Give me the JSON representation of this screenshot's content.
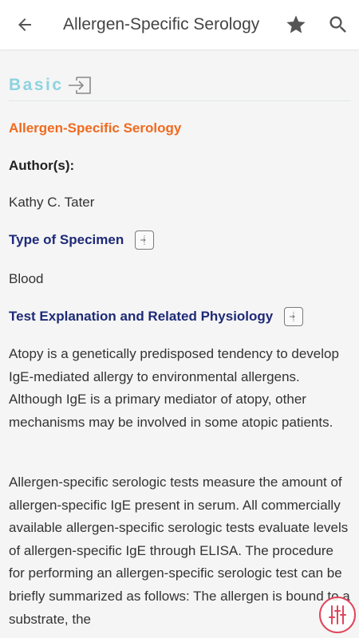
{
  "appbar": {
    "title": "Allergen-Specific Serology",
    "back_icon": "arrow-left-icon",
    "favorite_icon": "star-icon",
    "search_icon": "search-icon"
  },
  "section": {
    "label": "Basic",
    "icon": "enter-icon",
    "color": "#8dd3e0"
  },
  "document": {
    "title": "Allergen-Specific Serology",
    "title_color": "#f06a1e",
    "author_label": "Author(s):",
    "author_name": "Kathy C. Tater",
    "heading_color": "#1e2a78",
    "specimen_heading": "Type of Specimen",
    "specimen_value": "Blood",
    "physiology_heading": "Test Explanation and Related Physiology",
    "paragraphs": [
      "Atopy is a genetically predisposed tendency to develop IgE-mediated allergy to environmental allergens. Although IgE is a primary mediator of atopy, other mechanisms may be involved in some atopic patients.",
      "Allergen-specific serologic tests measure the amount of allergen-specific IgE present in serum. All commercially available allergen-specific serologic tests evaluate levels of allergen-specific IgE through ELISA. The procedure for performing an allergen-specific serologic test can be briefly summarized as follows: The allergen is bound to a substrate, the"
    ]
  },
  "fab": {
    "icon": "sliders-icon",
    "color": "#e0455a"
  }
}
